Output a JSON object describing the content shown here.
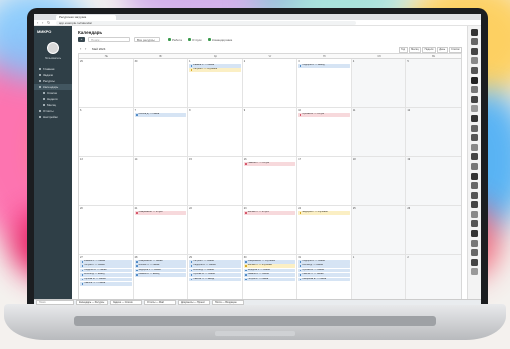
{
  "browser": {
    "tab_title": "Ресурсная загрузка",
    "url": "app.example.ru/calendar"
  },
  "sidebar": {
    "logo": "МИКРО",
    "user": "Пользователь",
    "items": [
      {
        "label": "Главная",
        "level": 0
      },
      {
        "label": "Задачи",
        "level": 0
      },
      {
        "label": "Ресурсы",
        "level": 0
      },
      {
        "label": "Календарь",
        "level": 0,
        "active": true
      },
      {
        "label": "Список",
        "level": 1
      },
      {
        "label": "Неделя",
        "level": 1
      },
      {
        "label": "Месяц",
        "level": 1
      },
      {
        "label": "Отчёты",
        "level": 0
      },
      {
        "label": "Настройки",
        "level": 0
      }
    ],
    "footer": "Выход"
  },
  "main": {
    "title": "Календарь",
    "add_label": "+",
    "search_placeholder": "Поиск...",
    "select_value": "Все ресурсы",
    "legend": [
      {
        "label": "Работа",
        "color": "#3a9a4c"
      },
      {
        "label": "Отпуск",
        "color": "#3a9a4c"
      },
      {
        "label": "Командировка",
        "color": "#3a9a4c"
      }
    ],
    "range": "Май 2024",
    "views": [
      "Год",
      "Месяц",
      "Неделя",
      "День",
      "Список"
    ]
  },
  "calendar": {
    "weekdays": [
      "Пн",
      "Вт",
      "Ср",
      "Чт",
      "Пт",
      "Сб",
      "Вс"
    ],
    "weeks": [
      [
        {
          "n": "29",
          "ev": []
        },
        {
          "n": "30",
          "ev": []
        },
        {
          "n": "1",
          "ev": [
            {
              "t": "Иванов А. — смена",
              "c": "blue"
            },
            {
              "t": "Петров К. — обучение",
              "c": "yellow"
            }
          ]
        },
        {
          "n": "2",
          "ev": []
        },
        {
          "n": "3",
          "ev": [
            {
              "t": "Сидоров В. — выезд",
              "c": "blue"
            }
          ]
        },
        {
          "n": "4",
          "ev": []
        },
        {
          "n": "5",
          "ev": []
        }
      ],
      [
        {
          "n": "6",
          "ev": []
        },
        {
          "n": "7",
          "ev": [
            {
              "t": "Козлов Д. — смена",
              "c": "blue"
            }
          ]
        },
        {
          "n": "8",
          "ev": []
        },
        {
          "n": "9",
          "ev": []
        },
        {
          "n": "10",
          "ev": [
            {
              "t": "Орлова М. — отпуск",
              "c": "red"
            }
          ]
        },
        {
          "n": "11",
          "ev": []
        },
        {
          "n": "12",
          "ev": []
        }
      ],
      [
        {
          "n": "13",
          "ev": []
        },
        {
          "n": "14",
          "ev": []
        },
        {
          "n": "15",
          "ev": []
        },
        {
          "n": "16",
          "ev": [
            {
              "t": "Павлов Н. — отпуск",
              "c": "red"
            }
          ]
        },
        {
          "n": "17",
          "ev": []
        },
        {
          "n": "18",
          "ev": []
        },
        {
          "n": "19",
          "ev": []
        }
      ],
      [
        {
          "n": "20",
          "ev": []
        },
        {
          "n": "21",
          "ev": [
            {
              "t": "Смирнова Е. — отпуск",
              "c": "red"
            }
          ]
        },
        {
          "n": "22",
          "ev": []
        },
        {
          "n": "23",
          "ev": [
            {
              "t": "Волков П. — отпуск",
              "c": "red"
            }
          ]
        },
        {
          "n": "24",
          "ev": [
            {
              "t": "Фёдоров Р. — обучение",
              "c": "yellow"
            }
          ]
        },
        {
          "n": "25",
          "ev": []
        },
        {
          "n": "26",
          "ev": []
        }
      ],
      [
        {
          "n": "27",
          "ev": [
            {
              "t": "Иванов А. — смена",
              "c": "blue"
            },
            {
              "t": "Петров К. — смена",
              "c": "blue"
            },
            {
              "t": "Сидоров В. — смена",
              "c": "blue"
            },
            {
              "t": "Козлов Д. — выезд",
              "c": "blue"
            },
            {
              "t": "Орлова М. — смена",
              "c": "blue"
            },
            {
              "t": "Павлов Н. — смена",
              "c": "blue"
            }
          ]
        },
        {
          "n": "28",
          "ev": [
            {
              "t": "Смирнова Е. — смена",
              "c": "blue"
            },
            {
              "t": "Волков П. — смена",
              "c": "blue"
            },
            {
              "t": "Фёдоров Р. — смена",
              "c": "blue"
            },
            {
              "t": "Иванов А. — выезд",
              "c": "blue"
            }
          ]
        },
        {
          "n": "29",
          "ev": [
            {
              "t": "Петров К. — смена",
              "c": "blue"
            },
            {
              "t": "Сидоров В. — смена",
              "c": "blue"
            },
            {
              "t": "Козлов Д. — смена",
              "c": "blue"
            },
            {
              "t": "Орлова М. — смена",
              "c": "blue"
            },
            {
              "t": "Павлов Н. — выезд",
              "c": "blue"
            }
          ]
        },
        {
          "n": "30",
          "ev": [
            {
              "t": "Смирнова Е. — обучение",
              "c": "blue"
            },
            {
              "t": "Волков П. — обучение",
              "c": "yellow"
            },
            {
              "t": "Фёдоров Р. — смена",
              "c": "blue"
            },
            {
              "t": "Иванов А. — смена",
              "c": "blue"
            },
            {
              "t": "Петров К. — смена",
              "c": "blue"
            }
          ]
        },
        {
          "n": "31",
          "ev": [
            {
              "t": "Сидоров В. — смена",
              "c": "blue"
            },
            {
              "t": "Козлов Д. — смена",
              "c": "blue"
            },
            {
              "t": "Орлова М. — смена",
              "c": "blue"
            },
            {
              "t": "Павлов Н. — смена",
              "c": "blue"
            },
            {
              "t": "Смирнова Е. — смена",
              "c": "blue"
            }
          ]
        },
        {
          "n": "1",
          "ev": []
        },
        {
          "n": "2",
          "ev": []
        }
      ]
    ]
  },
  "right_toolbar": {
    "icon_colors": [
      "#333333",
      "#666666",
      "#444444",
      "#888888",
      "#555555",
      "#222222",
      "#777777",
      "#444444",
      "#999999",
      "#333333",
      "#666666",
      "#555555",
      "#888888",
      "#444444",
      "#777777",
      "#333333",
      "#666666",
      "#555555",
      "#444444",
      "#888888",
      "#555555",
      "#333333",
      "#777777",
      "#666666",
      "#444444",
      "#999999"
    ]
  },
  "taskbar": {
    "search_placeholder": "Поиск",
    "items": [
      "Календарь — Ресурсы",
      "Задачи — Список",
      "Отчёты — Май",
      "Документы — Проект",
      "Почта — Входящие"
    ]
  }
}
